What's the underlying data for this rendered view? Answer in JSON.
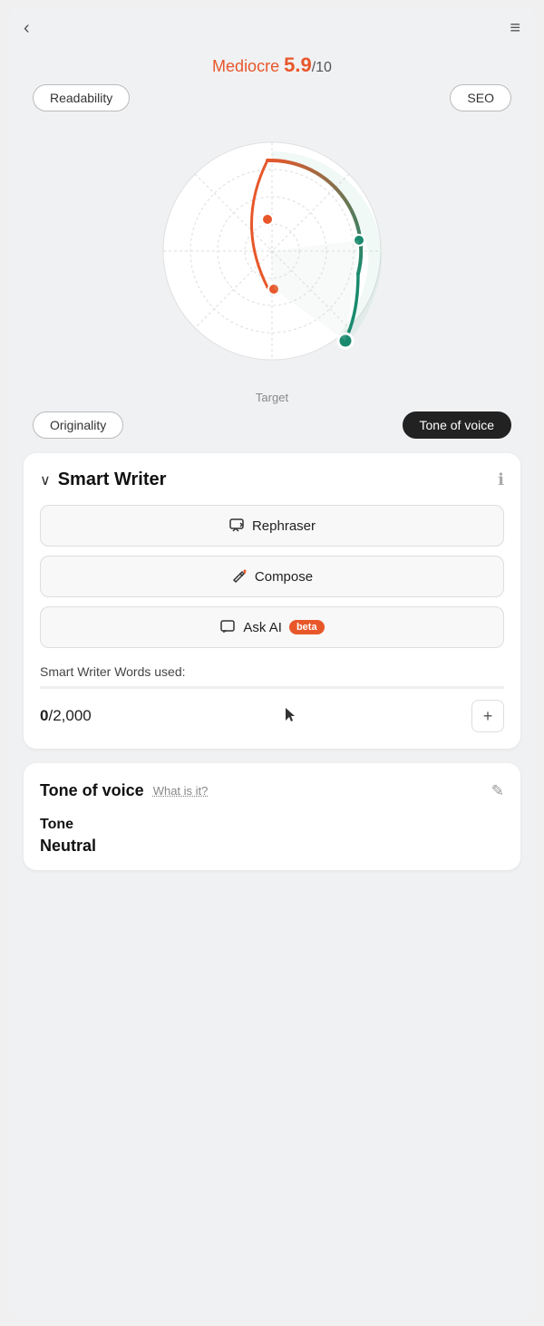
{
  "header": {
    "back_label": "‹",
    "menu_label": "≡"
  },
  "score": {
    "label": "Mediocre",
    "value": "5.9",
    "denom": "/10"
  },
  "radar": {
    "top_left_btn": "Readability",
    "top_right_btn": "SEO",
    "target_label": "Target",
    "bottom_left_btn": "Originality",
    "bottom_right_btn": "Tone of voice"
  },
  "smart_writer": {
    "title": "Smart Writer",
    "chevron": "∨",
    "info_icon": "ℹ",
    "rephraser_label": "Rephraser",
    "compose_label": "Compose",
    "ask_ai_label": "Ask AI",
    "beta_label": "beta",
    "words_used_label": "Smart Writer Words used:",
    "words_used": "0",
    "words_total": "2,000",
    "add_btn_label": "+"
  },
  "tone_of_voice": {
    "title": "Tone of voice",
    "what_is_it_label": "What is it?",
    "edit_icon": "✎",
    "tone_label": "Tone",
    "tone_value": "Neutral"
  }
}
